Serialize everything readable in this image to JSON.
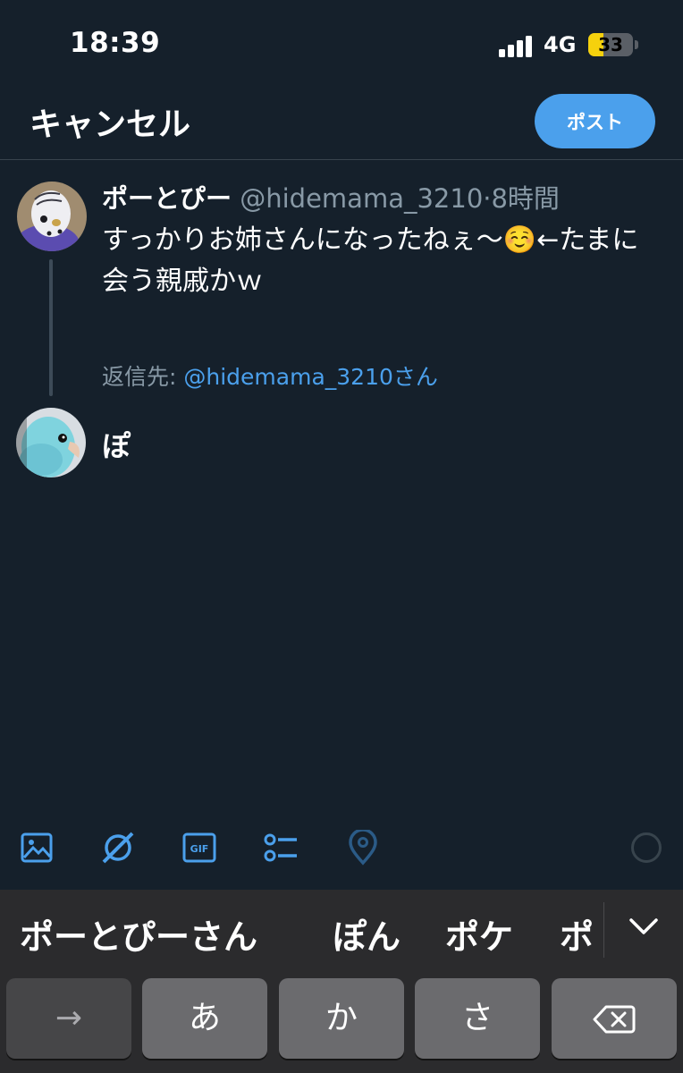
{
  "status": {
    "time": "18:39",
    "network": "4G",
    "battery_level": "33",
    "battery_fraction": 0.33
  },
  "header": {
    "cancel_label": "キャンセル",
    "post_label": "ポスト"
  },
  "original_tweet": {
    "name": "ポーとぴー",
    "handle": "@hidemama_3210",
    "separator": "·",
    "time": "8時間",
    "text": "すっかりお姉さんになったねぇ〜☺️←たまに会う親戚かｗ"
  },
  "reply": {
    "prefix": "返信先: ",
    "mention": "@hidemama_3210さん"
  },
  "compose": {
    "text": "ぽ"
  },
  "toolbar": {
    "icons": [
      "image-icon",
      "grok-icon",
      "gif-icon",
      "poll-icon",
      "location-icon",
      "character-counter"
    ]
  },
  "keyboard": {
    "suggestions": [
      "ポーとぴーさん",
      "ぽん",
      "ポケ",
      "ポ"
    ],
    "keys": [
      "→",
      "あ",
      "か",
      "さ",
      "delete-icon"
    ]
  },
  "colors": {
    "background": "#15202b",
    "accent": "#4ba0ec",
    "muted": "#8899a6",
    "keyboard": "#2b2b2d"
  }
}
